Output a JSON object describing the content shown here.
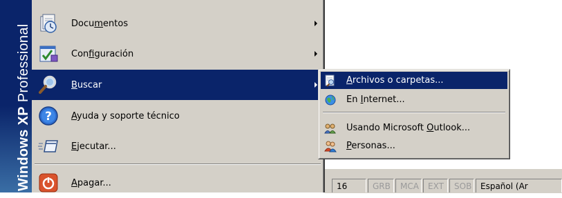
{
  "start_menu": {
    "banner": {
      "brand": "Windows XP",
      "edition": "Professional"
    },
    "items": [
      {
        "prefix": "Docu",
        "accel": "m",
        "rest": "entos",
        "icon": "documents-icon",
        "has_submenu": true
      },
      {
        "prefix": "Con",
        "accel": "f",
        "rest": "iguración",
        "icon": "settings-icon",
        "has_submenu": true
      },
      {
        "prefix": "",
        "accel": "B",
        "rest": "uscar",
        "icon": "search-icon",
        "has_submenu": true,
        "selected": true
      },
      {
        "prefix": "",
        "accel": "A",
        "rest": "yuda y soporte técnico",
        "icon": "help-icon",
        "has_submenu": false
      },
      {
        "prefix": "",
        "accel": "E",
        "rest": "jecutar...",
        "icon": "run-icon",
        "has_submenu": false
      },
      {
        "prefix": "",
        "accel": "A",
        "rest": "pagar...",
        "icon": "shutdown-icon",
        "has_submenu": false
      }
    ]
  },
  "search_submenu": {
    "items": [
      {
        "prefix": "",
        "accel": "A",
        "rest": "rchivos o carpetas...",
        "icon": "search-files-icon",
        "selected": true
      },
      {
        "prefix": "En ",
        "accel": "I",
        "rest": "nternet...",
        "icon": "internet-search-icon"
      },
      {
        "prefix": "Usando Microsoft ",
        "accel": "O",
        "rest": "utlook...",
        "icon": "outlook-icon"
      },
      {
        "prefix": "",
        "accel": "P",
        "rest": "ersonas...",
        "icon": "people-icon"
      }
    ]
  },
  "status_bar": {
    "page": "16",
    "grb": "GRB",
    "mca": "MCA",
    "ext": "EXT",
    "sob": "SOB",
    "language": "Español (Ar"
  },
  "colors": {
    "menu_face": "#d4d0c8",
    "selection": "#0a246a",
    "banner_top": "#0a246a",
    "banner_bottom": "#3a6ea5"
  }
}
